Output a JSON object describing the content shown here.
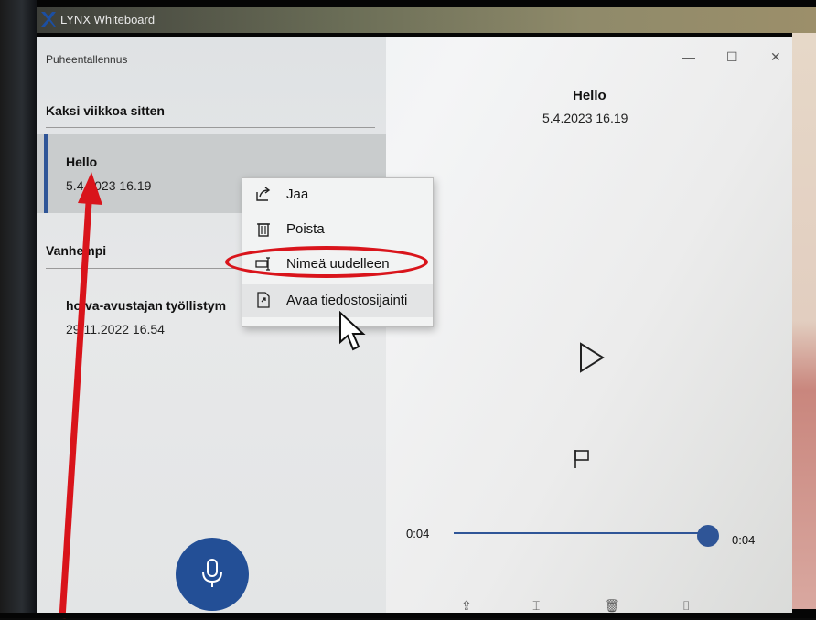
{
  "window": {
    "app_name": "LYNX Whiteboard"
  },
  "app": {
    "title": "Puheentallennus",
    "minimize": "—",
    "maximize": "☐",
    "close": "✕"
  },
  "groups": [
    {
      "header": "Kaksi viikkoa sitten",
      "items": [
        {
          "title": "Hello",
          "date": "5.4.2023 16.19",
          "selected": true
        }
      ]
    },
    {
      "header": "Vanhempi",
      "items": [
        {
          "title": "hoiva-avustajan työllistym",
          "date": "29.11.2022 16.54",
          "selected": false
        }
      ]
    }
  ],
  "detail": {
    "title": "Hello",
    "date": "5.4.2023 16.19"
  },
  "player": {
    "elapsed": "0:04",
    "total": "0:04",
    "progress": 1.0
  },
  "context_menu": {
    "items": [
      {
        "label": "Jaa",
        "icon": "share-icon"
      },
      {
        "label": "Poista",
        "icon": "trash-icon"
      },
      {
        "label": "Nimeä uudelleen",
        "icon": "rename-icon"
      },
      {
        "label": "Avaa tiedostosijainti",
        "icon": "open-location-icon"
      }
    ]
  },
  "colors": {
    "accent": "#2f5597",
    "annotation": "#d9141b"
  }
}
